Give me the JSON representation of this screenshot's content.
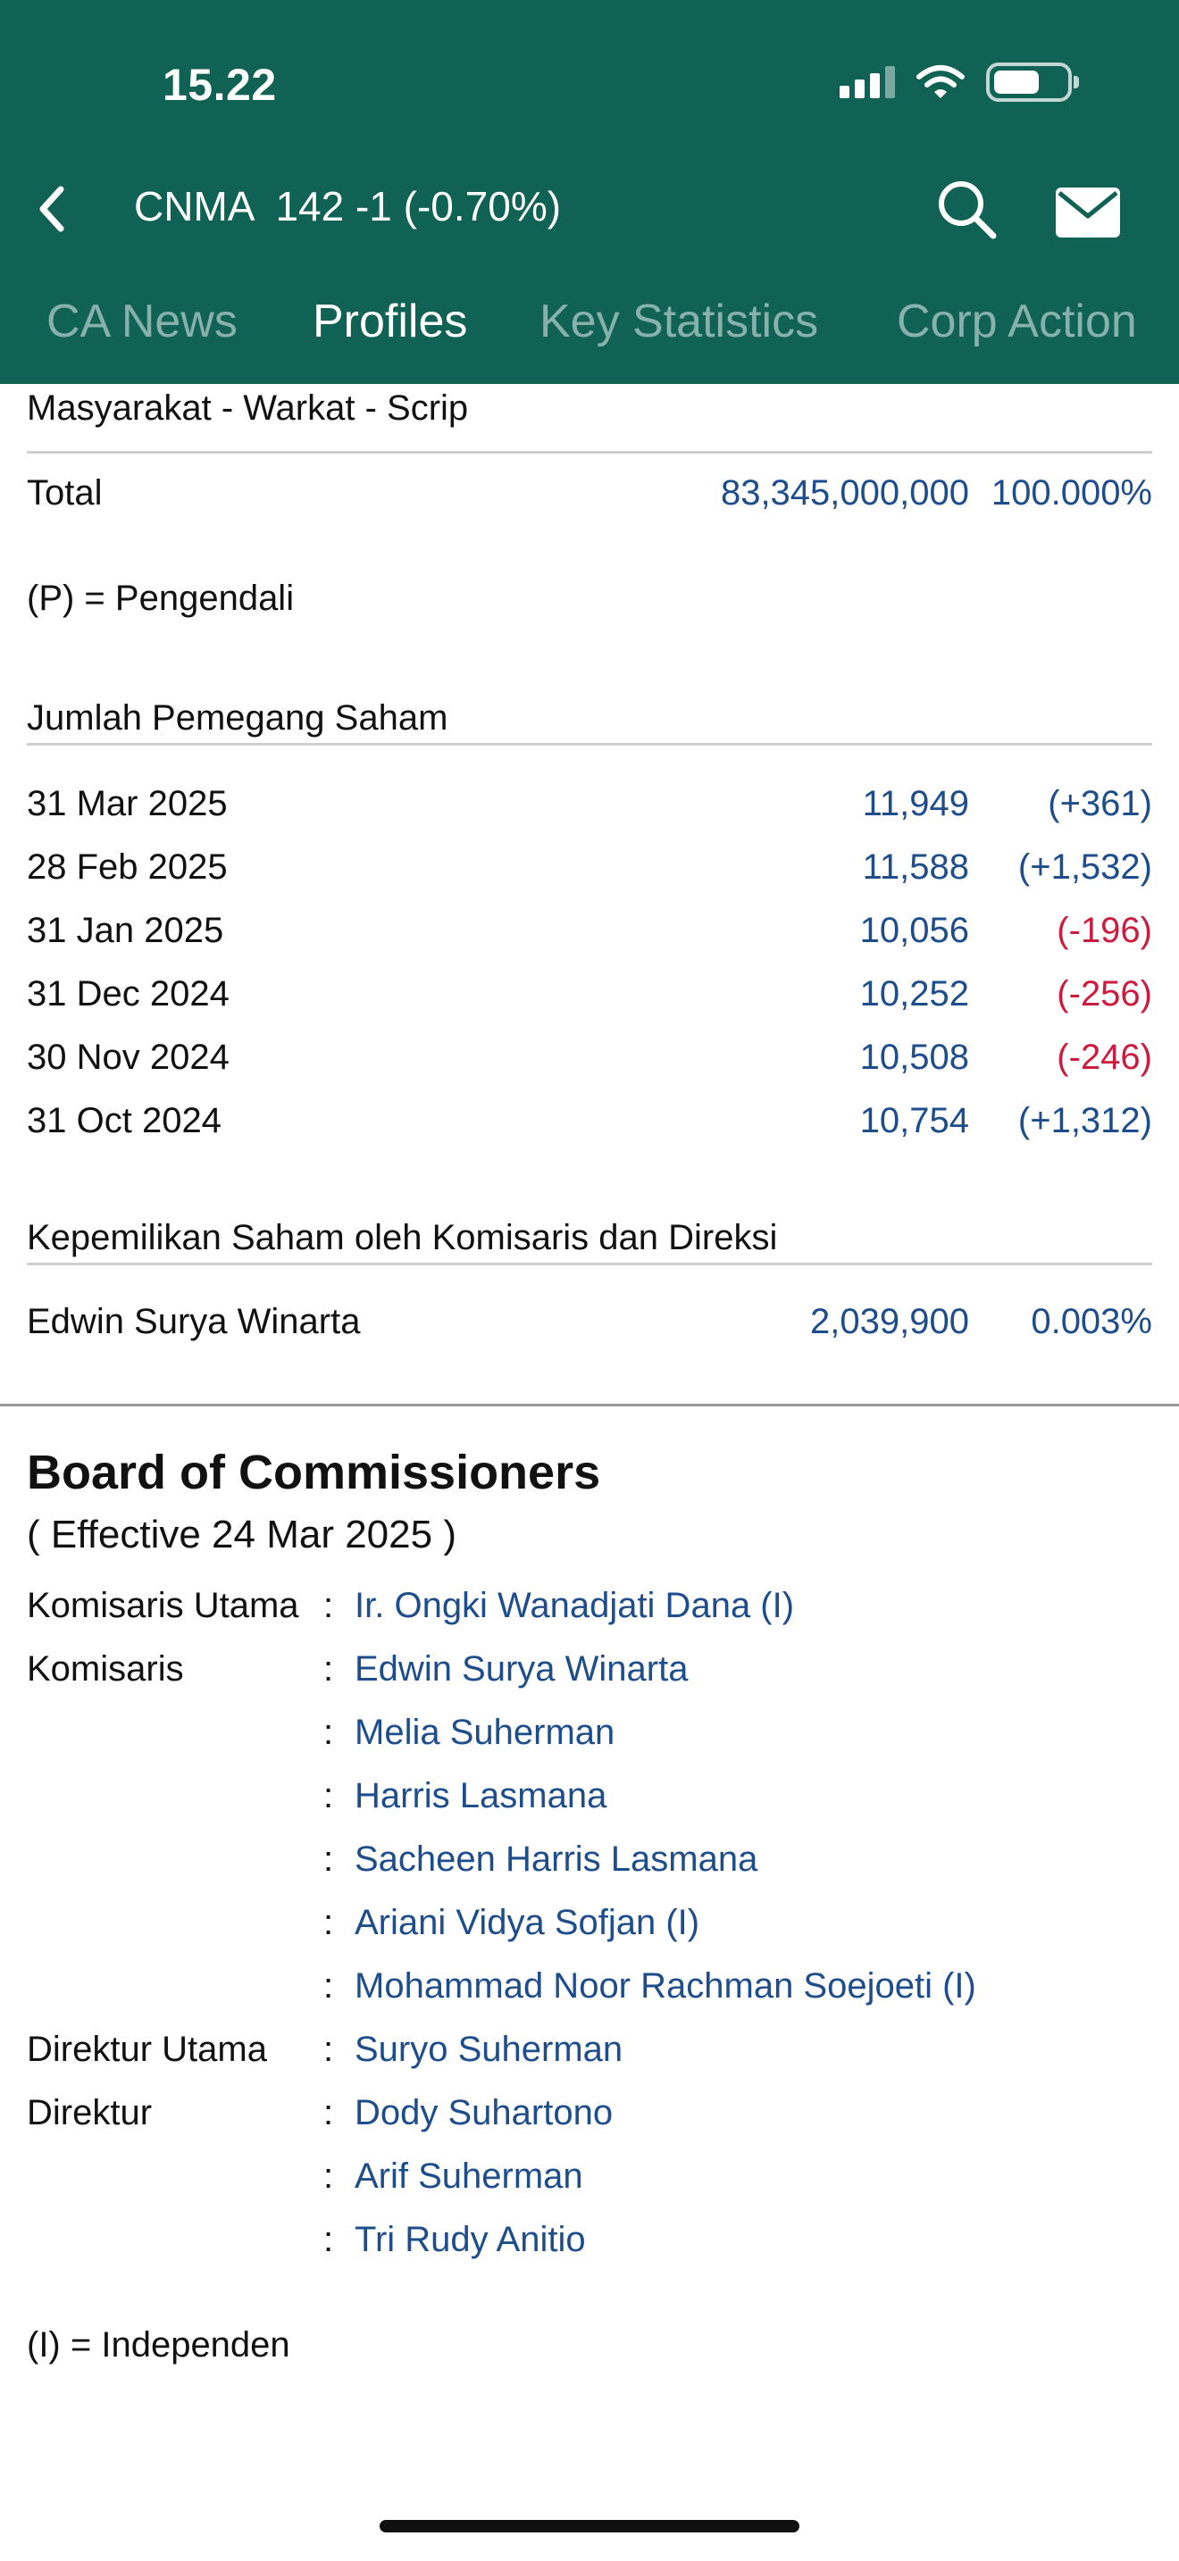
{
  "status_bar": {
    "time": "15.22"
  },
  "nav": {
    "ticker_text": "CNMA  142 -1 (-0.70%)"
  },
  "tabs": [
    {
      "label": "CA News",
      "active": false
    },
    {
      "label": "Profiles",
      "active": true
    },
    {
      "label": "Key Statistics",
      "active": false
    },
    {
      "label": "Corp Action",
      "active": false
    }
  ],
  "shareholders": {
    "last_row_label": "Masyarakat - Warkat - Scrip",
    "total_label": "Total",
    "total_shares": "83,345,000,000",
    "total_percent": "100.000%",
    "pengendali_note": "(P) = Pengendali"
  },
  "holders_count": {
    "title": "Jumlah Pemegang Saham",
    "rows": [
      {
        "date": "31 Mar 2025",
        "count": "11,949",
        "change": "(+361)",
        "negative": false
      },
      {
        "date": "28 Feb 2025",
        "count": "11,588",
        "change": "(+1,532)",
        "negative": false
      },
      {
        "date": "31 Jan 2025",
        "count": "10,056",
        "change": "(-196)",
        "negative": true
      },
      {
        "date": "31 Dec 2024",
        "count": "10,252",
        "change": "(-256)",
        "negative": true
      },
      {
        "date": "30 Nov 2024",
        "count": "10,508",
        "change": "(-246)",
        "negative": true
      },
      {
        "date": "31 Oct 2024",
        "count": "10,754",
        "change": "(+1,312)",
        "negative": false
      }
    ]
  },
  "insider_ownership": {
    "title": "Kepemilikan Saham oleh Komisaris dan Direksi",
    "rows": [
      {
        "name": "Edwin Surya Winarta",
        "shares": "2,039,900",
        "percent": "0.003%"
      }
    ]
  },
  "board": {
    "title": "Board of Commissioners",
    "effective": "( Effective 24 Mar 2025 )",
    "rows": [
      {
        "role": "Komisaris Utama",
        "name": "Ir. Ongki Wanadjati Dana (I)"
      },
      {
        "role": "Komisaris",
        "name": "Edwin Surya Winarta"
      },
      {
        "role": "",
        "name": "Melia Suherman"
      },
      {
        "role": "",
        "name": "Harris Lasmana"
      },
      {
        "role": "",
        "name": "Sacheen Harris Lasmana"
      },
      {
        "role": "",
        "name": "Ariani Vidya Sofjan (I)"
      },
      {
        "role": "",
        "name": "Mohammad Noor Rachman Soejoeti (I)"
      },
      {
        "role": "Direktur Utama",
        "name": "Suryo Suherman"
      },
      {
        "role": "Direktur",
        "name": "Dody Suhartono"
      },
      {
        "role": "",
        "name": "Arif Suherman"
      },
      {
        "role": "",
        "name": "Tri Rudy Anitio"
      }
    ],
    "colon": ":",
    "independen_note": "(I) = Independen"
  },
  "colors": {
    "header_bg": "#0f6254",
    "value_blue": "#1e4d8c",
    "negative_red": "#cc1b3e"
  },
  "icons": [
    "back-chevron-icon",
    "search-icon",
    "mail-icon",
    "signal-icon",
    "wifi-icon",
    "battery-icon"
  ]
}
